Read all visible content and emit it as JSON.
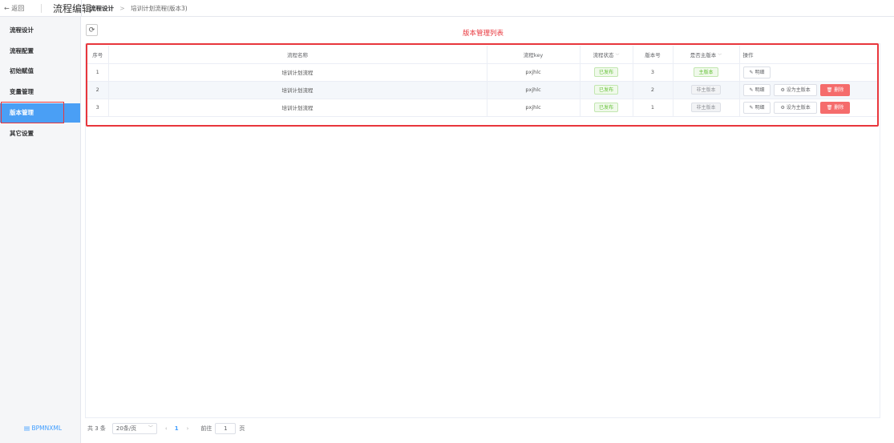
{
  "header": {
    "back_label": "← 返回",
    "app_title": "流程编辑",
    "breadcrumb": {
      "current": "流程设计",
      "separator": ">",
      "page": "培训计划流程(版本3)"
    }
  },
  "sidebar": {
    "items": [
      {
        "label": "流程设计"
      },
      {
        "label": "流程配置"
      },
      {
        "label": "初始赋值"
      },
      {
        "label": "变量管理"
      },
      {
        "label": "版本管理"
      },
      {
        "label": "其它设置"
      }
    ],
    "active_index": 4,
    "bpmn_label": "BPMNXML"
  },
  "main": {
    "refresh_icon": "refresh-icon",
    "list_title": "版本管理列表",
    "columns": [
      "序号",
      "流程名称",
      "流程key",
      "流程状态",
      "版本号",
      "是否主版本",
      "操作"
    ],
    "rows": [
      {
        "index": "1",
        "name": "培训计划流程",
        "key": "pxjhlc",
        "status": "已发布",
        "version": "3",
        "main_flag": "主版本",
        "is_main": true
      },
      {
        "index": "2",
        "name": "培训计划流程",
        "key": "pxjhlc",
        "status": "已发布",
        "version": "2",
        "main_flag": "非主版本",
        "is_main": false
      },
      {
        "index": "3",
        "name": "培训计划流程",
        "key": "pxjhlc",
        "status": "已发布",
        "version": "1",
        "main_flag": "非主版本",
        "is_main": false
      }
    ],
    "actions": {
      "detail": "明细",
      "set_main": "设为主版本",
      "delete": "删除"
    }
  },
  "pagination": {
    "total": "共 3 条",
    "page_size": "20条/页",
    "current_page": "1",
    "goto_label": "前往",
    "goto_value": "1",
    "page_unit": "页"
  },
  "colors": {
    "accent": "#409eff",
    "sidebar_active": "#4a9ff5",
    "highlight": "#e8363c",
    "danger": "#f56c6c",
    "success": "#67c23a"
  }
}
